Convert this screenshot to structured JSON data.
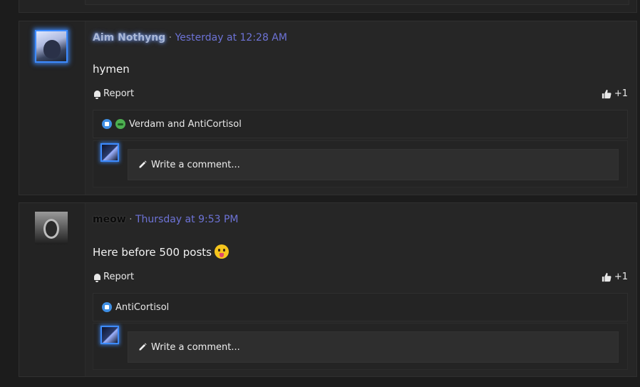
{
  "posts": [
    {
      "username": "Aim Nothyng",
      "separator": "·",
      "timestamp": "Yesterday at 12:28 AM",
      "content": "hymen",
      "report_label": "Report",
      "plus_label": "+1",
      "reactions_text": "Verdam and AntiCortisol",
      "reaction_icons": [
        "like-icon",
        "sick-face-icon"
      ],
      "comment_placeholder": "Write a comment..."
    },
    {
      "username": "meow",
      "separator": "·",
      "timestamp": "Thursday at 9:53 PM",
      "content": "Here before 500 posts",
      "content_emoji": "tongue-out-emoji",
      "report_label": "Report",
      "plus_label": "+1",
      "reactions_text": "AntiCortisol",
      "reaction_icons": [
        "like-icon"
      ],
      "comment_placeholder": "Write a comment..."
    }
  ],
  "colors": {
    "background": "#1c1c1c",
    "post_bg": "#262626",
    "timestamp": "#6d73d6",
    "avatar_glow": "#3d8bff"
  }
}
